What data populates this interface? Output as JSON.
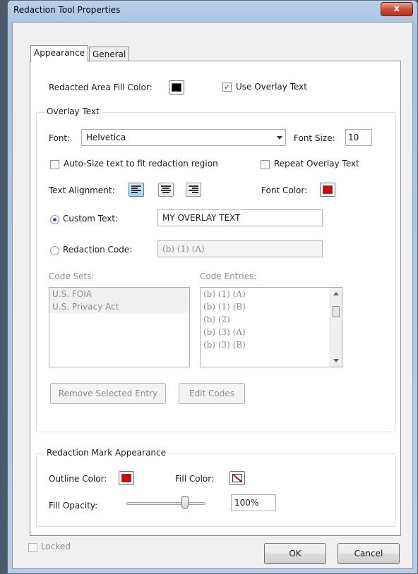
{
  "window": {
    "title": "Redaction Tool Properties",
    "close_glyph": "x"
  },
  "tabs": [
    {
      "label": "Appearance",
      "active": true
    },
    {
      "label": "General",
      "active": false
    }
  ],
  "appearance": {
    "fill_color_label": "Redacted Area Fill Color:",
    "fill_color": "#000000",
    "use_overlay_label": "Use Overlay Text",
    "use_overlay_checked": true,
    "overlay_group_title": "Overlay Text",
    "font_label": "Font:",
    "font_value": "Helvetica",
    "font_size_label": "Font Size:",
    "font_size_value": "10",
    "autosize_label": "Auto-Size text to fit redaction region",
    "repeat_label": "Repeat Overlay Text",
    "alignment_label": "Text Alignment:",
    "font_color_label": "Font Color:",
    "font_color": "#e00000",
    "custom_text_label": "Custom Text:",
    "custom_text_value": "MY OVERLAY TEXT",
    "redaction_code_label": "Redaction Code:",
    "redaction_code_value": "(b) (1) (A)",
    "code_sets_label": "Code Sets:",
    "code_entries_label": "Code Entries:",
    "code_sets": [
      "U.S. FOIA",
      "U.S. Privacy Act"
    ],
    "code_entries": [
      "(b) (1) (A)",
      "(b) (1) (B)",
      "(b) (2)",
      "(b) (3) (A)",
      "(b) (3) (B)"
    ],
    "remove_entry_label": "Remove Selected Entry",
    "edit_codes_label": "Edit Codes",
    "mark_group_title": "Redaction Mark Appearance",
    "outline_color_label": "Outline Color:",
    "outline_color": "#e00000",
    "mark_fill_color_label": "Fill Color:",
    "fill_opacity_label": "Fill Opacity:",
    "fill_opacity_value": "100%",
    "fill_opacity_fraction": 1.0
  },
  "footer": {
    "locked_label": "Locked",
    "ok_label": "OK",
    "cancel_label": "Cancel"
  }
}
